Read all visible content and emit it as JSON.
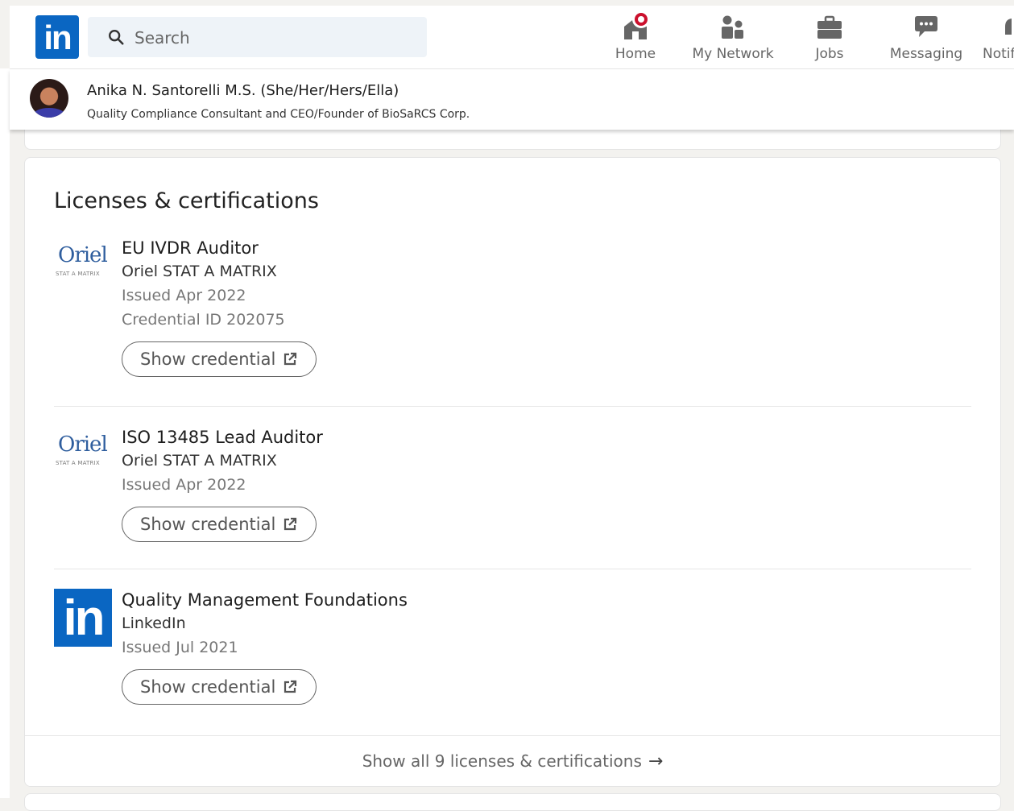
{
  "nav": {
    "search_placeholder": "Search",
    "items": [
      {
        "label": "Home",
        "icon": "home-icon"
      },
      {
        "label": "My Network",
        "icon": "people-icon"
      },
      {
        "label": "Jobs",
        "icon": "briefcase-icon"
      },
      {
        "label": "Messaging",
        "icon": "chat-icon"
      },
      {
        "label": "Notif",
        "icon": "bell-icon"
      }
    ]
  },
  "profile": {
    "name": "Anika N. Santorelli M.S. (She/Her/Hers/Ella)",
    "headline": "Quality Compliance Consultant and CEO/Founder of BioSaRCS Corp."
  },
  "licenses": {
    "title": "Licenses & certifications",
    "entries": [
      {
        "logo_word": "Oriel",
        "logo_sub": "STAT A MATRIX",
        "title": "EU IVDR Auditor",
        "org": "Oriel STAT A MATRIX",
        "issued": "Issued Apr 2022",
        "credential_id": "Credential ID 202075",
        "button": "Show credential"
      },
      {
        "logo_word": "Oriel",
        "logo_sub": "STAT A MATRIX",
        "title": "ISO 13485 Lead Auditor",
        "org": "Oriel STAT A MATRIX",
        "issued": "Issued Apr 2022",
        "button": "Show credential"
      },
      {
        "logo_word": "in",
        "title": "Quality Management Foundations",
        "org": "LinkedIn",
        "issued": "Issued Jul 2021",
        "button": "Show credential"
      }
    ],
    "show_all": "Show all 9 licenses & certifications",
    "show_all_arrow": "→"
  },
  "colors": {
    "linkedin_blue": "#0a66c2",
    "notification_red": "#cb112d",
    "oriel_blue": "#2f5e9e"
  }
}
